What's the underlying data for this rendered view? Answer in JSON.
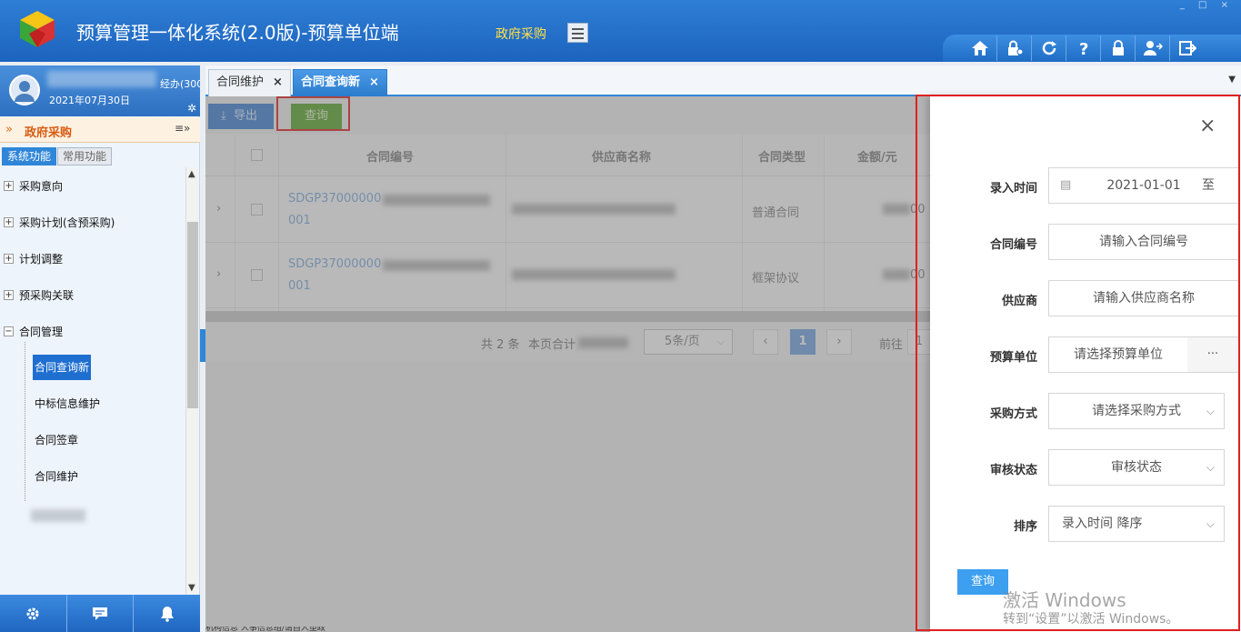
{
  "header": {
    "title": "预算管理一体化系统(2.0版)-预算单位端",
    "module": "政府采购",
    "window_controls": "_ □ ×",
    "toolbar_icons": [
      "home-icon",
      "lock-gear-icon",
      "refresh-icon",
      "help-icon",
      "lock-icon",
      "user-switch-icon",
      "exit-icon"
    ]
  },
  "sidebar": {
    "user_role": "经办(300",
    "user_date": "2021年07月30日",
    "section_title": "政府采购",
    "section_chevron": "»",
    "section_options": "≡»",
    "tabs": [
      "系统功能",
      "常用功能"
    ],
    "tree": [
      {
        "label": "采购意向",
        "expanded": false
      },
      {
        "label": "采购计划(含预采购)",
        "expanded": false
      },
      {
        "label": "计划调整",
        "expanded": false
      },
      {
        "label": "预采购关联",
        "expanded": false
      },
      {
        "label": "合同管理",
        "expanded": true
      }
    ],
    "leaves": [
      "合同查询新",
      "中标信息维护",
      "合同签章",
      "合同维护"
    ],
    "active_leaf": "合同查询新",
    "expand_sign": "⊞",
    "collapse_sign": "⊟"
  },
  "tabs": [
    {
      "label": "合同维护",
      "close": "×"
    },
    {
      "label": "合同查询新",
      "close": "×"
    }
  ],
  "toolbar": {
    "export_label": "导出",
    "export_icon": "⤓",
    "query_label": "查询"
  },
  "table": {
    "headers": [
      "合同编号",
      "供应商名称",
      "合同类型",
      "金额/元"
    ],
    "rows": [
      {
        "contract_no_a": "SDGP37000000",
        "contract_no_b": "001",
        "type": "普通合同",
        "amount_suffix": "00"
      },
      {
        "contract_no_a": "SDGP37000000",
        "contract_no_b": "001",
        "type": "框架协议",
        "amount_suffix": "00"
      }
    ],
    "expand_glyph": "›"
  },
  "pager": {
    "total": "共 2 条",
    "page_sum_label": "本页合计",
    "page_size": "5条/页",
    "current_page": "1",
    "goto_label": "前往",
    "goto_value": "1",
    "prev": "‹",
    "next": "›"
  },
  "drawer": {
    "close": "×",
    "fields": [
      {
        "label": "录入时间",
        "value": "2021-01-01",
        "suffix": "至"
      },
      {
        "label": "合同编号",
        "placeholder": "请输入合同编号"
      },
      {
        "label": "供应商",
        "placeholder": "请输入供应商名称"
      },
      {
        "label": "预算单位",
        "placeholder": "请选择预算单位",
        "button": "···"
      },
      {
        "label": "采购方式",
        "placeholder": "请选择采购方式"
      },
      {
        "label": "审核状态",
        "placeholder": "审核状态"
      },
      {
        "label": "排序",
        "value": "录入时间  降序"
      }
    ],
    "query_label": "查询",
    "caret": "⌵"
  },
  "watermark": {
    "line1": "激活 Windows",
    "line2": "转到“设置”以激活 Windows。"
  },
  "statusbar": "机构信息   人事信息组/请自人塑政"
}
